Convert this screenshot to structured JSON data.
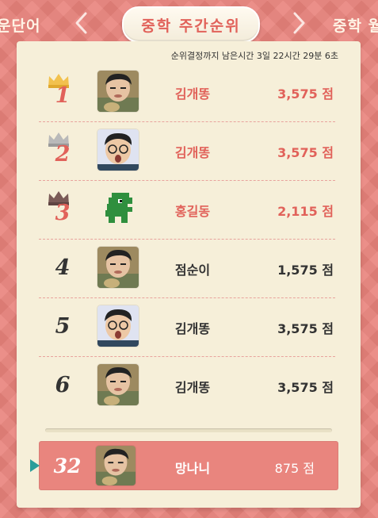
{
  "header": {
    "title": "중학 주간순위",
    "left_tab": "운단어",
    "right_tab": "중학 월",
    "prev_icon": "chevron-left-icon",
    "next_icon": "chevron-right-icon"
  },
  "timer_text": "순위결정까지 남은시간 3일 22시간 29분 6초",
  "ranking": [
    {
      "rank": "1",
      "name": "김개똥",
      "score": "3,575 점",
      "crown": "gold",
      "avatar": "boy-photo"
    },
    {
      "rank": "2",
      "name": "김개똥",
      "score": "3,575 점",
      "crown": "silver",
      "avatar": "boy-glasses-photo"
    },
    {
      "rank": "3",
      "name": "홍길동",
      "score": "2,115 점",
      "crown": "bronze",
      "avatar": "pixel-dino"
    },
    {
      "rank": "4",
      "name": "점순이",
      "score": "1,575 점",
      "crown": "",
      "avatar": "boy-photo"
    },
    {
      "rank": "5",
      "name": "김개똥",
      "score": "3,575 점",
      "crown": "",
      "avatar": "boy-glasses-photo"
    },
    {
      "rank": "6",
      "name": "김개똥",
      "score": "3,575 점",
      "crown": "",
      "avatar": "boy-photo"
    }
  ],
  "my_rank": {
    "rank": "32",
    "name": "망나니",
    "score": "875 점",
    "avatar": "boy-photo",
    "marker_icon": "play-marker-icon"
  },
  "colors": {
    "background": "#e9837c",
    "panel": "#f6efd9",
    "accent": "#e1625a",
    "my_row": "#e9857e",
    "gold": "#f2c14e",
    "silver": "#b9b9b9",
    "bronze": "#7a5a57",
    "marker": "#2a9d9a"
  }
}
